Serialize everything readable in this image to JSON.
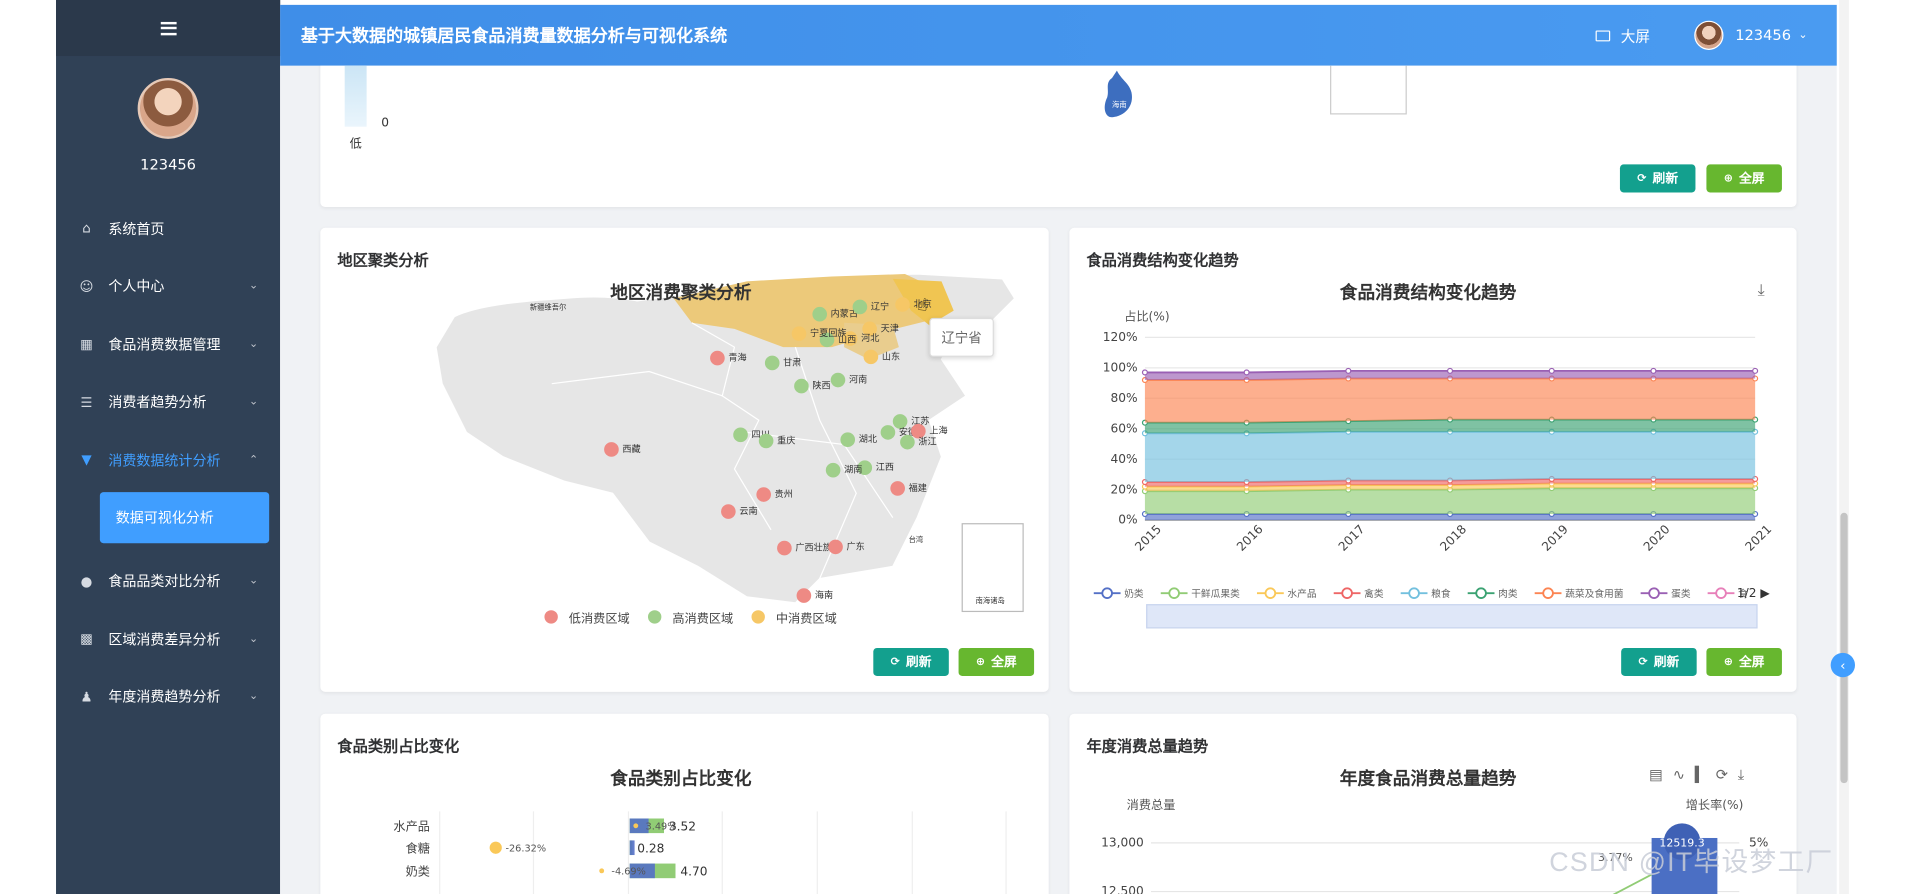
{
  "app": {
    "title": "基于大数据的城镇居民食品消费量数据分析与可视化系统",
    "bigscreen_label": "大屏",
    "username": "123456"
  },
  "sidebar": {
    "username": "123456",
    "items": [
      {
        "label": "系统首页",
        "icon": "home-icon"
      },
      {
        "label": "个人中心",
        "icon": "user-icon"
      },
      {
        "label": "食品消费数据管理",
        "icon": "grid-icon"
      },
      {
        "label": "消费者趋势分析",
        "icon": "list-icon"
      },
      {
        "label": "消费数据统计分析",
        "icon": "chart-icon"
      },
      {
        "label": "食品品类对比分析",
        "icon": "pin-icon"
      },
      {
        "label": "区域消费差异分析",
        "icon": "monitor-icon"
      },
      {
        "label": "年度消费趋势分析",
        "icon": "person-icon"
      }
    ],
    "submenu": {
      "label": "数据可视化分析"
    }
  },
  "buttons": {
    "refresh": "刷新",
    "fullscreen": "全屏"
  },
  "top_card": {
    "legend_low": "低",
    "legend_zero": "0",
    "map_label": "海南"
  },
  "cluster_card": {
    "header": "地区聚类分析",
    "chart_title": "地区消费聚类分析",
    "tooltip": "辽宁省",
    "legend": [
      "低消费区域",
      "高消费区域",
      "中消费区域"
    ],
    "legend_colors": [
      "#ee8a84",
      "#9fcf8a",
      "#f6c766"
    ],
    "province_labels": [
      "内蒙古",
      "辽宁",
      "北京",
      "天津",
      "河北",
      "山西",
      "宁夏回族",
      "甘肃",
      "青海",
      "陕西",
      "河南",
      "山东",
      "江苏",
      "安徽",
      "上海",
      "湖北",
      "浙江",
      "四川",
      "重庆",
      "西藏",
      "江西",
      "湖南",
      "贵州",
      "云南",
      "福建",
      "广西壮族",
      "广东",
      "海南",
      "新疆维吾尔",
      "南海诸岛",
      "台湾"
    ]
  },
  "structure_card": {
    "header": "食品消费结构变化趋势",
    "chart_title": "食品消费结构变化趋势",
    "legend_page": "1/2"
  },
  "ratio_card": {
    "header": "食品类别占比变化",
    "chart_title": "食品类别占比变化"
  },
  "total_card": {
    "header": "年度消费总量趋势",
    "chart_title": "年度食品消费总量趋势",
    "ylabel_left": "消费总量",
    "ylabel_right": "增长率(%)"
  },
  "watermark": "CSDN @IT毕设梦工厂",
  "chart_data": [
    {
      "type": "area",
      "title": "食品消费结构变化趋势",
      "ylabel": "占比(%)",
      "x": [
        "2015",
        "2016",
        "2017",
        "2018",
        "2019",
        "2020",
        "2021"
      ],
      "yticks": [
        "0%",
        "20%",
        "40%",
        "60%",
        "80%",
        "100%",
        "120%"
      ],
      "ylim": [
        0,
        120
      ],
      "stacked": true,
      "legend": [
        "奶类",
        "干鲜瓜果类",
        "水产品",
        "禽类",
        "粮食",
        "肉类",
        "蔬菜及食用菌",
        "蛋类",
        "食"
      ],
      "series": [
        {
          "name": "奶类",
          "color": "#5470c6",
          "values": [
            4,
            4,
            4,
            4,
            4,
            4,
            4
          ]
        },
        {
          "name": "干鲜瓜果类",
          "color": "#91cc75",
          "values": [
            15,
            15,
            16,
            16,
            17,
            17,
            17
          ]
        },
        {
          "name": "水产品",
          "color": "#fac858",
          "values": [
            3,
            3,
            3,
            3,
            3,
            3,
            3
          ]
        },
        {
          "name": "禽类",
          "color": "#ee6666",
          "values": [
            3,
            3,
            3,
            3,
            3,
            3,
            3
          ]
        },
        {
          "name": "粮食",
          "color": "#73c0de",
          "values": [
            32,
            32,
            32,
            32,
            31,
            31,
            31
          ]
        },
        {
          "name": "肉类",
          "color": "#3ba272",
          "values": [
            7,
            7,
            7,
            8,
            8,
            8,
            8
          ]
        },
        {
          "name": "蔬菜及食用菌",
          "color": "#fc8452",
          "values": [
            28,
            28,
            28,
            27,
            27,
            27,
            27
          ]
        },
        {
          "name": "蛋类",
          "color": "#9a60b4",
          "values": [
            5,
            5,
            5,
            5,
            5,
            5,
            5
          ]
        }
      ]
    },
    {
      "type": "bar",
      "title": "食品类别占比变化",
      "categories": [
        "水产品",
        "食糖",
        "奶类"
      ],
      "value_labels": [
        "3.52",
        "0.28",
        "4.70"
      ],
      "values": [
        3.52,
        0.28,
        4.7
      ],
      "change_labels": [
        "3.49%",
        "-26.32%",
        "-4.69%"
      ]
    },
    {
      "type": "bar",
      "title": "年度食品消费总量趋势",
      "yticks_left": [
        "12,500",
        "13,000"
      ],
      "yticks_right": [
        "5%"
      ],
      "annotations": [
        "12519.3",
        "3.77%"
      ]
    }
  ]
}
